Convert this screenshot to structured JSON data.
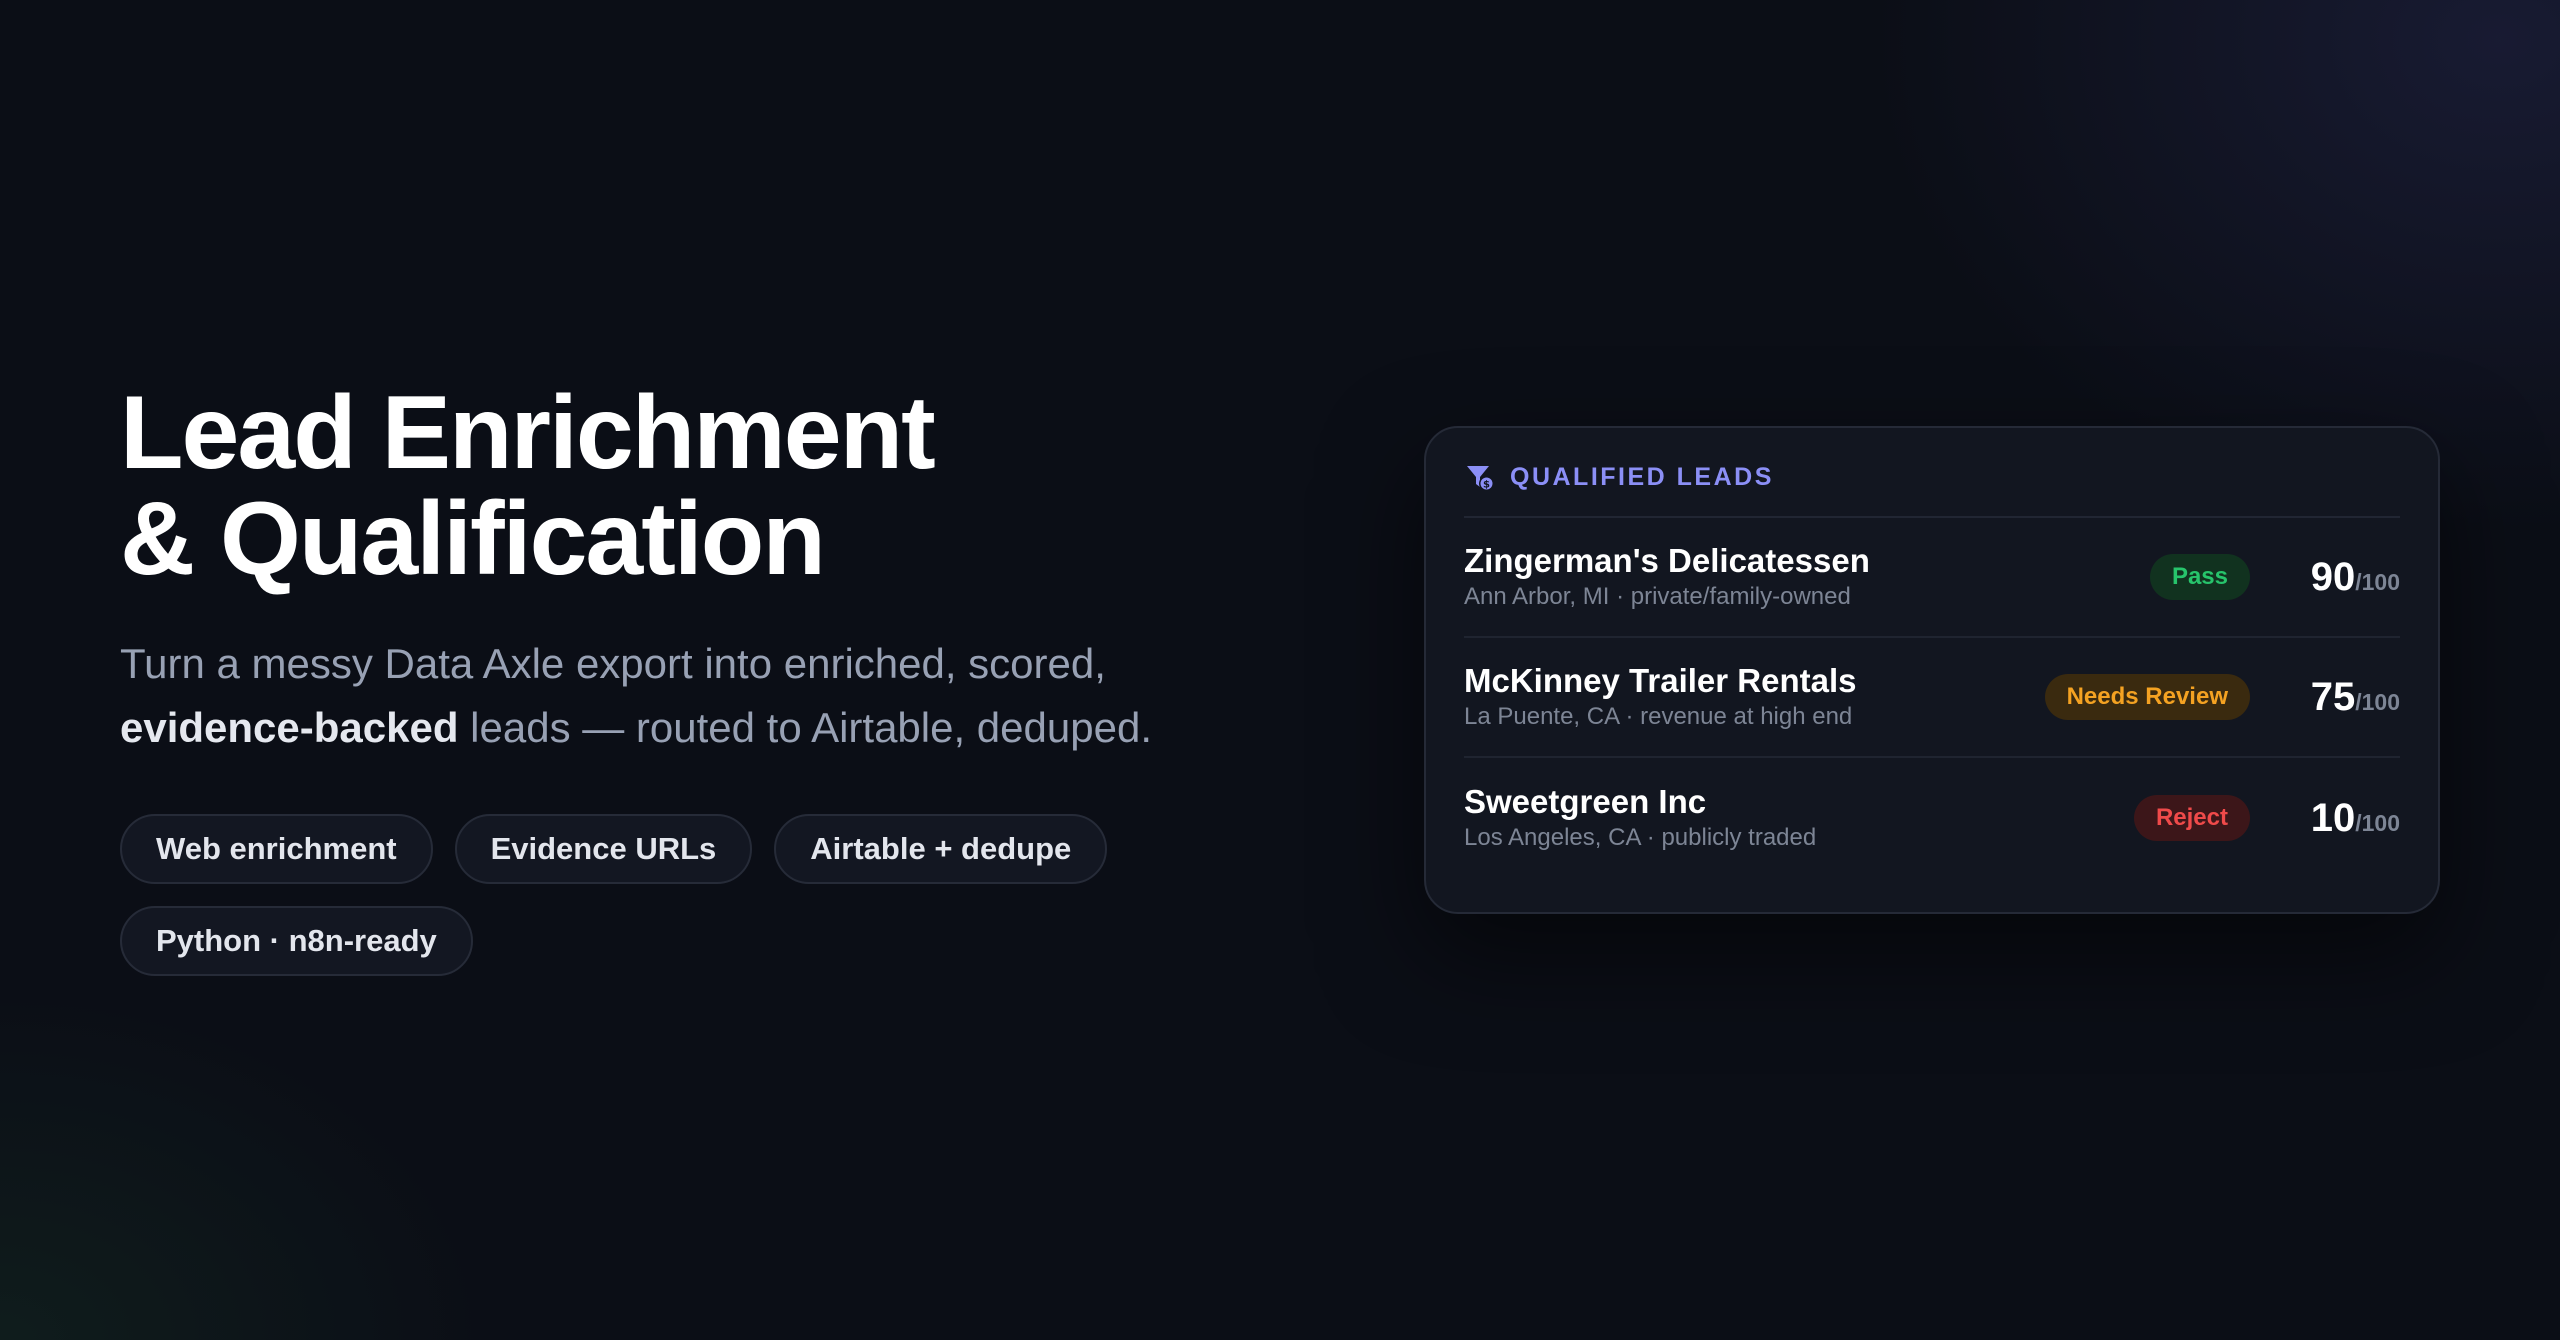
{
  "hero": {
    "title_line1": "Lead Enrichment",
    "title_line2": "& Qualification",
    "subtitle_pre": "Turn a messy Data Axle export into enriched, scored, ",
    "subtitle_bold": "evidence-backed",
    "subtitle_post": " leads — routed to Airtable, deduped.",
    "chips": [
      "Web enrichment",
      "Evidence URLs",
      "Airtable + dedupe",
      "Python · n8n-ready"
    ]
  },
  "card": {
    "title": "QUALIFIED LEADS",
    "icon": "filter-dollar-icon",
    "leads": [
      {
        "name": "Zingerman's Delicatessen",
        "meta": "Ann Arbor, MI · private/family-owned",
        "status": "Pass",
        "score": "90",
        "score_max": "/100"
      },
      {
        "name": "McKinney Trailer Rentals",
        "meta": "La Puente, CA · revenue at high end",
        "status": "Needs Review",
        "score": "75",
        "score_max": "/100"
      },
      {
        "name": "Sweetgreen Inc",
        "meta": "Los Angeles, CA · publicly traded",
        "status": "Reject",
        "score": "10",
        "score_max": "/100"
      }
    ]
  },
  "colors": {
    "background": "#0b0e16",
    "accent": "#8b8ff6",
    "pass": "#27c46b",
    "review": "#f4a222",
    "reject": "#ef4a4a"
  }
}
